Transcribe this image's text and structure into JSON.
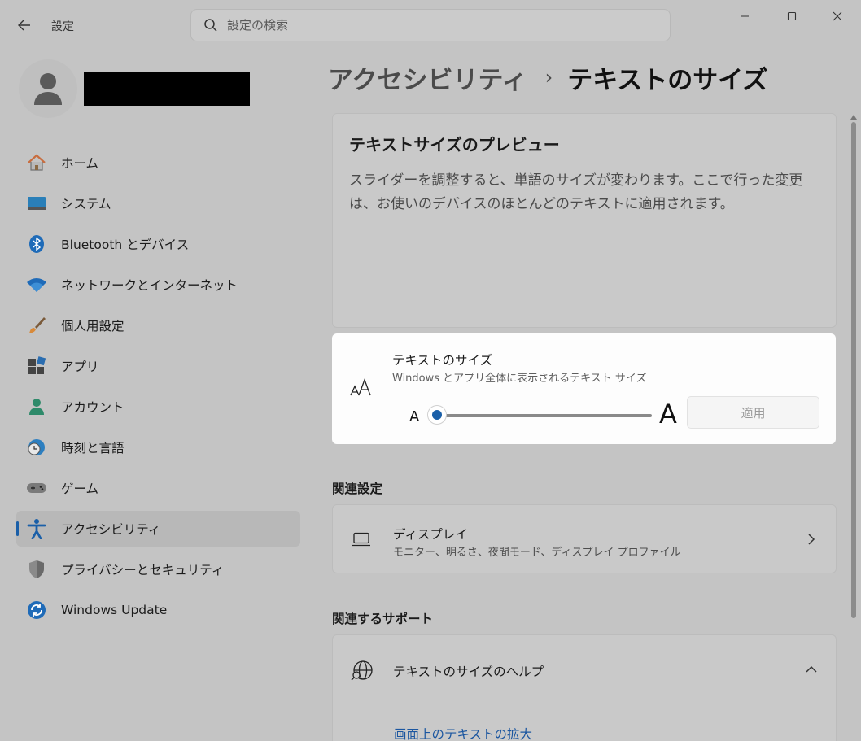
{
  "window": {
    "app_title": "設定",
    "search_placeholder": "設定の検索"
  },
  "breadcrumb": {
    "parent": "アクセシビリティ",
    "separator": "›",
    "current": "テキストのサイズ"
  },
  "sidebar": {
    "items": [
      {
        "label": "ホーム",
        "icon": "home-icon"
      },
      {
        "label": "システム",
        "icon": "system-icon"
      },
      {
        "label": "Bluetooth とデバイス",
        "icon": "bluetooth-icon"
      },
      {
        "label": "ネットワークとインターネット",
        "icon": "wifi-icon"
      },
      {
        "label": "個人用設定",
        "icon": "brush-icon"
      },
      {
        "label": "アプリ",
        "icon": "apps-icon"
      },
      {
        "label": "アカウント",
        "icon": "account-icon"
      },
      {
        "label": "時刻と言語",
        "icon": "clock-globe-icon"
      },
      {
        "label": "ゲーム",
        "icon": "gamepad-icon"
      },
      {
        "label": "アクセシビリティ",
        "icon": "accessibility-icon",
        "selected": true
      },
      {
        "label": "プライバシーとセキュリティ",
        "icon": "shield-icon"
      },
      {
        "label": "Windows Update",
        "icon": "update-icon"
      }
    ]
  },
  "preview": {
    "title": "テキストサイズのプレビュー",
    "text": "スライダーを調整すると、単語のサイズが変わります。ここで行った変更は、お使いのデバイスのほとんどのテキストに適用されます。"
  },
  "text_size": {
    "title": "テキストのサイズ",
    "description": "Windows とアプリ全体に表示されるテキスト サイズ",
    "small_label": "A",
    "large_label": "A",
    "slider_value_fraction": 0.0,
    "apply_label": "適用",
    "accent_color": "#1a5fa8"
  },
  "related_settings": {
    "heading": "関連設定",
    "display": {
      "title": "ディスプレイ",
      "description": "モニター、明るさ、夜間モード、ディスプレイ プロファイル"
    }
  },
  "related_support": {
    "heading": "関連するサポート",
    "help_title": "テキストのサイズのヘルプ",
    "link": "画面上のテキストの拡大"
  }
}
